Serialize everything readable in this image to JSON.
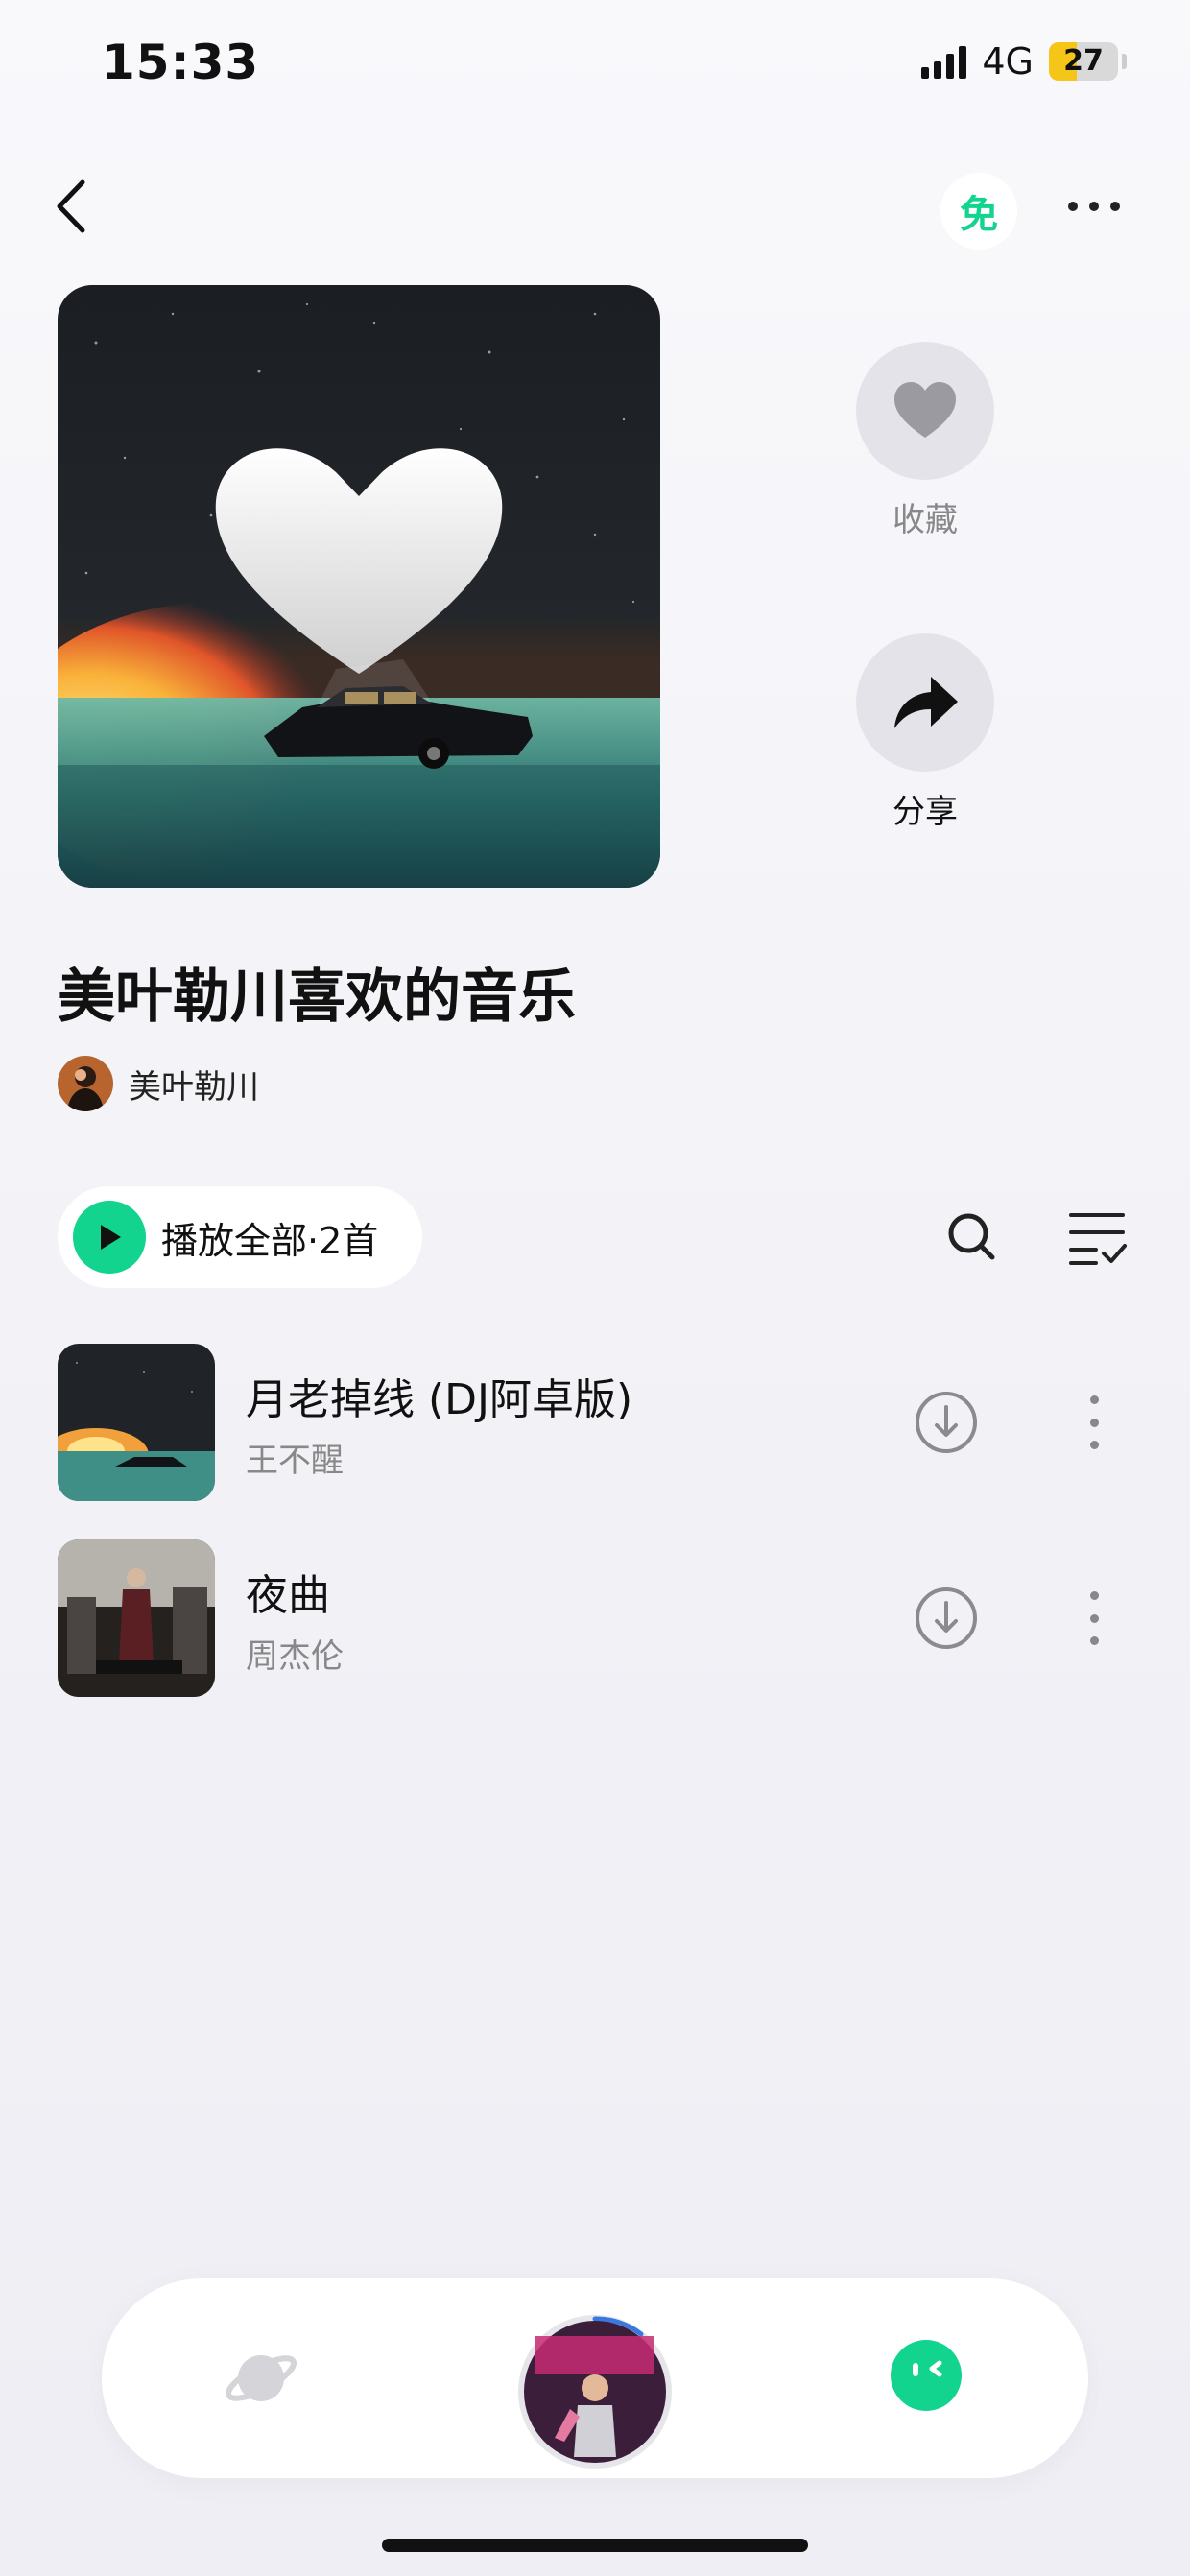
{
  "status_bar": {
    "time": "15:33",
    "network": "4G",
    "battery": "27"
  },
  "top_nav": {
    "free_badge": "免",
    "icons": [
      "chevron-left-icon",
      "more-horizontal-icon"
    ]
  },
  "playlist": {
    "title": "美叶勒川喜欢的音乐",
    "creator": "美叶勒川",
    "actions": {
      "favorite_label": "收藏",
      "share_label": "分享"
    }
  },
  "toolbar": {
    "play_all_label": "播放全部·2首",
    "icons": [
      "search-icon",
      "multi-select-icon"
    ]
  },
  "songs": [
    {
      "title": "月老掉线 (DJ阿卓版)",
      "artist": "王不醒"
    },
    {
      "title": "夜曲",
      "artist": "周杰伦"
    }
  ],
  "bottom_nav": {
    "icons": [
      "planet-icon",
      "now-playing-disc",
      "profile-face-icon"
    ]
  },
  "colors": {
    "accent": "#12d48f",
    "background": "#f1f1f6",
    "secondary_text": "#888888"
  }
}
